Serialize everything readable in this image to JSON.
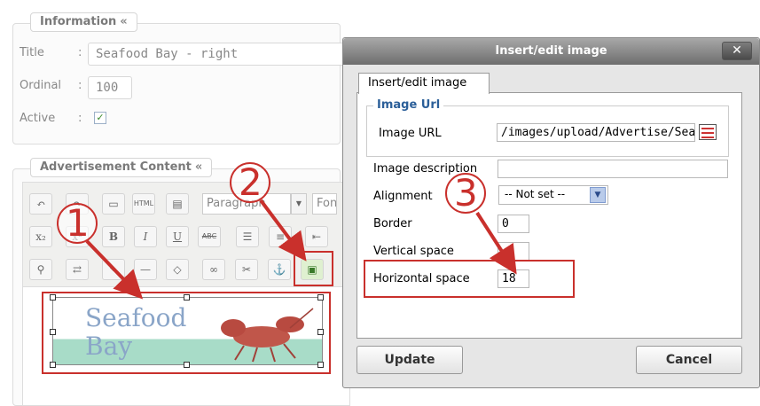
{
  "information": {
    "legend": "Information",
    "collapse_glyph": "«",
    "title_label": "Title",
    "title_value": "Seafood Bay - right",
    "ordinal_label": "Ordinal",
    "ordinal_value": "100",
    "active_label": "Active",
    "active_checked": true,
    "colon": ":"
  },
  "advertisement": {
    "legend": "Advertisement Content",
    "collapse_glyph": "«",
    "format_select": "Paragraph",
    "font_select": "Font",
    "toolbar_html_label": "HTML",
    "toolbar_bold": "B",
    "toolbar_italic": "I",
    "toolbar_underline": "U",
    "toolbar_strike": "ABC",
    "image_text_line1": "Seafood",
    "image_text_line2": "Bay",
    "image_icon": "lobster-illustration"
  },
  "callouts": [
    "1",
    "2",
    "3"
  ],
  "dialog": {
    "title": "Insert/edit image",
    "close_glyph": "✕",
    "tab": "Insert/edit image",
    "group_legend": "Image Url",
    "image_url_label": "Image URL",
    "image_url_value": "/images/upload/Advertise/Sea",
    "image_description_label": "Image description",
    "image_description_value": "",
    "alignment_label": "Alignment",
    "alignment_value": "-- Not set --",
    "border_label": "Border",
    "border_value": "0",
    "vertical_space_label": "Vertical space",
    "vertical_space_value": "",
    "horizontal_space_label": "Horizontal space",
    "horizontal_space_value": "18",
    "update_button": "Update",
    "cancel_button": "Cancel"
  },
  "colors": {
    "callout_red": "#c9302c",
    "dialog_title_bar": "#7a7a7a",
    "legend_blue": "#2b5f99"
  }
}
